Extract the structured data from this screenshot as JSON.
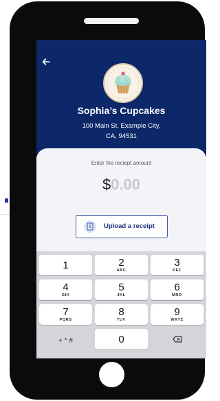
{
  "business": {
    "name": "Sophia’s Cupcakes",
    "address_line1": "100 Main St, Example City,",
    "address_line2": "CA, 94531"
  },
  "icons": {
    "back": "arrow-left-icon",
    "logo": "cupcake-logo",
    "upload": "receipt-icon",
    "delete": "backspace-icon"
  },
  "receipt": {
    "prompt": "Enter the reciept amount",
    "currency": "$",
    "amount": "0.00"
  },
  "upload_button": {
    "label": "Upload a receipt"
  },
  "keypad": {
    "keys": [
      {
        "digit": "1",
        "letters": ""
      },
      {
        "digit": "2",
        "letters": "ABC"
      },
      {
        "digit": "3",
        "letters": "DEF"
      },
      {
        "digit": "4",
        "letters": "GHI"
      },
      {
        "digit": "5",
        "letters": "JKL"
      },
      {
        "digit": "6",
        "letters": "MNO"
      },
      {
        "digit": "7",
        "letters": "PQRS"
      },
      {
        "digit": "8",
        "letters": "TUV"
      },
      {
        "digit": "9",
        "letters": "WXYZ"
      },
      {
        "digit": "+ * #",
        "letters": ""
      },
      {
        "digit": "0",
        "letters": ""
      }
    ]
  },
  "colors": {
    "header": "#0c2869",
    "accent": "#3f58a8",
    "keypad_bg": "#d3d5da"
  }
}
